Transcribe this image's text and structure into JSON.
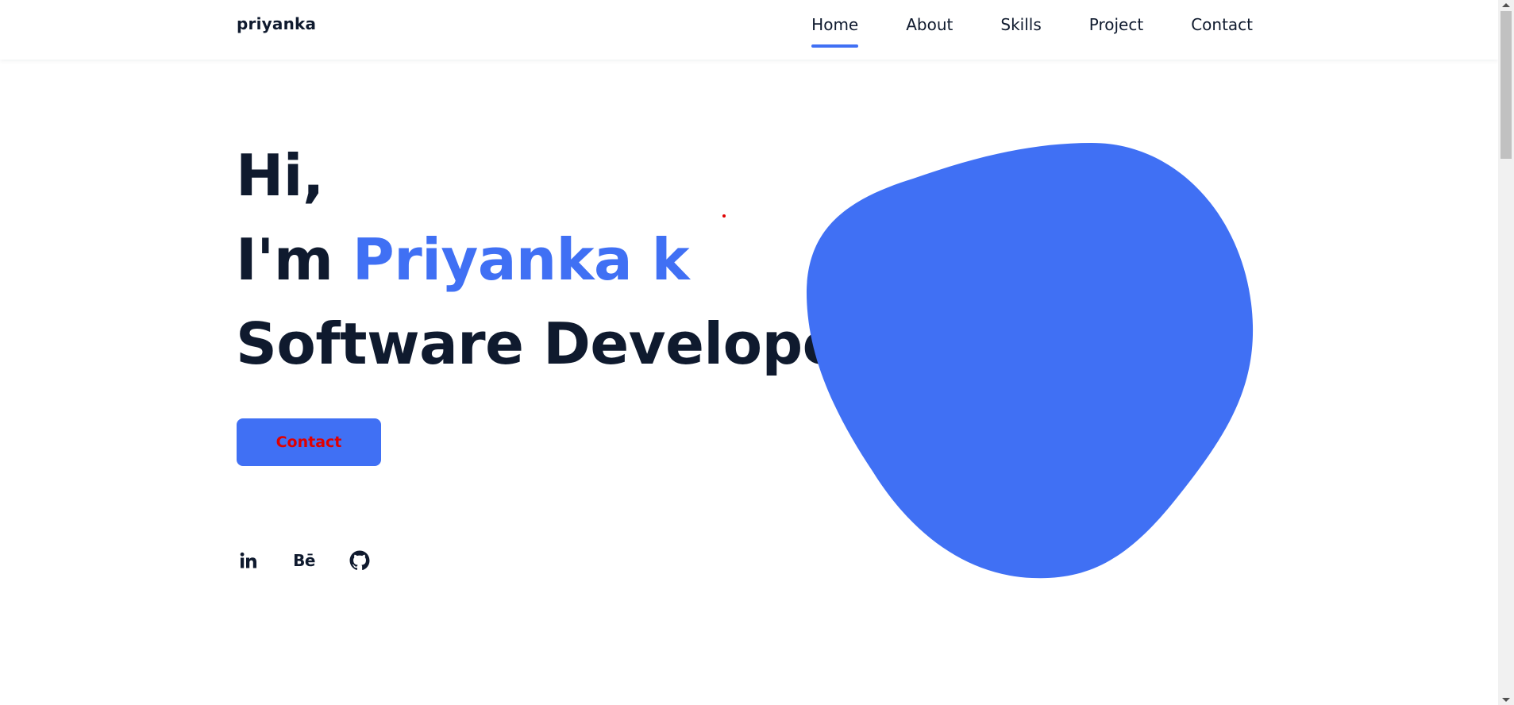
{
  "header": {
    "logo": "priyanka",
    "nav": [
      {
        "label": "Home",
        "active": true
      },
      {
        "label": "About",
        "active": false
      },
      {
        "label": "Skills",
        "active": false
      },
      {
        "label": "Project",
        "active": false
      },
      {
        "label": "Contact",
        "active": false
      }
    ]
  },
  "hero": {
    "greeting": "Hi,",
    "intro_prefix": "I'm ",
    "name": "Priyanka k",
    "role": "Software Developer",
    "contact_button": "Contact"
  },
  "social": {
    "icons": [
      "linkedin-icon",
      "behance-icon",
      "github-icon"
    ],
    "behance_text": "Bē"
  },
  "colors": {
    "accent": "#4070f4",
    "text": "#0f1a2e",
    "button_text": "#e00000"
  }
}
